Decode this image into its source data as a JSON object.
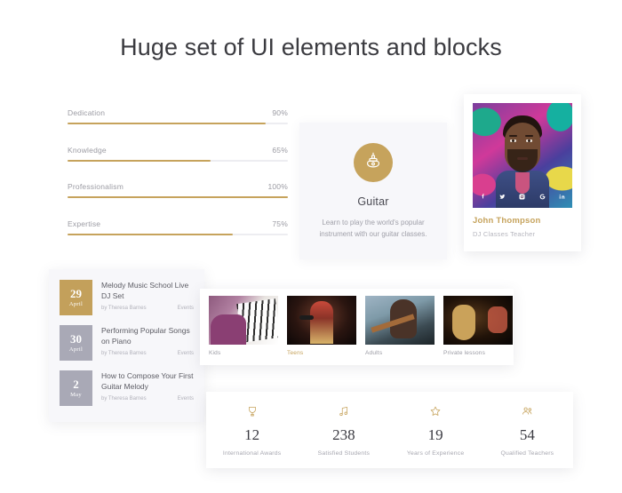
{
  "header": {
    "title": "Huge set of UI elements and blocks"
  },
  "skills": {
    "items": [
      {
        "label": "Dedication",
        "percent_label": "90%",
        "value": 90
      },
      {
        "label": "Knowledge",
        "percent_label": "65%",
        "value": 65
      },
      {
        "label": "Professionalism",
        "percent_label": "100%",
        "value": 100
      },
      {
        "label": "Expertise",
        "percent_label": "75%",
        "value": 75
      }
    ]
  },
  "service_card": {
    "icon": "guitar-icon",
    "title": "Guitar",
    "description": "Learn to play the world's popular instrument with our guitar classes."
  },
  "teacher_card": {
    "name": "John Thompson",
    "role": "DJ Classes Teacher",
    "socials": [
      {
        "name": "facebook-icon",
        "glyph": "f"
      },
      {
        "name": "twitter-icon",
        "glyph": "t"
      },
      {
        "name": "instagram-icon",
        "glyph": "i"
      },
      {
        "name": "google-icon",
        "glyph": "G"
      },
      {
        "name": "linkedin-icon",
        "glyph": "in"
      }
    ]
  },
  "events": {
    "items": [
      {
        "day": "29",
        "month": "April",
        "title": "Melody Music School Live DJ Set",
        "author": "by Theresa Barnes",
        "category": "Events",
        "highlight": true
      },
      {
        "day": "30",
        "month": "April",
        "title": "Performing Popular Songs on Piano",
        "author": "by Theresa Barnes",
        "category": "Events",
        "highlight": false
      },
      {
        "day": "2",
        "month": "May",
        "title": "How to Compose Your First Guitar Melody",
        "author": "by Theresa Barnes",
        "category": "Events",
        "highlight": false
      }
    ]
  },
  "gallery": {
    "items": [
      {
        "label": "Kids",
        "active": false
      },
      {
        "label": "Teens",
        "active": true
      },
      {
        "label": "Adults",
        "active": false
      },
      {
        "label": "Private lessons",
        "active": false
      }
    ]
  },
  "stats": {
    "items": [
      {
        "icon": "trophy-icon",
        "value": "12",
        "label": "International Awards"
      },
      {
        "icon": "music-note-icon",
        "value": "238",
        "label": "Satisfied Students"
      },
      {
        "icon": "star-icon",
        "value": "19",
        "label": "Years of Experience"
      },
      {
        "icon": "people-icon",
        "value": "54",
        "label": "Qualified Teachers"
      }
    ]
  },
  "colors": {
    "accent_gold": "#c6a35c",
    "badge_gray": "#a9a9b6",
    "title_text": "#3b3b40",
    "muted_text": "#a0a0a9",
    "card_bg_light": "#f7f7fa",
    "card_bg_white": "#ffffff"
  }
}
